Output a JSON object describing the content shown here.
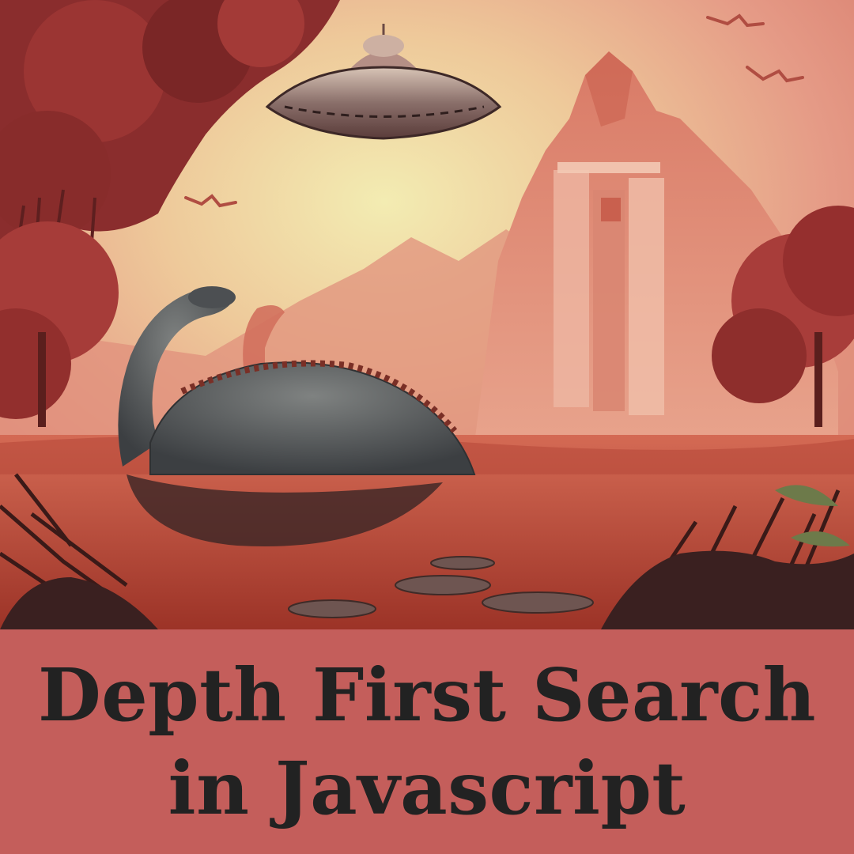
{
  "title": {
    "line1": "Depth First Search",
    "line2": "in Javascript"
  },
  "illustration": {
    "subjects": [
      "flying-saucer-icon",
      "dinosaur-icon",
      "pterodactyl-icon",
      "mountain-temple-icon",
      "tree-icon"
    ]
  },
  "colors": {
    "title_band": "#c45e5b",
    "title_text": "#222222",
    "sky_light": "#f1e6a8",
    "sky_pink": "#e6a08a",
    "swamp": "#c4553e",
    "dinosaur": "#4a4e50"
  }
}
